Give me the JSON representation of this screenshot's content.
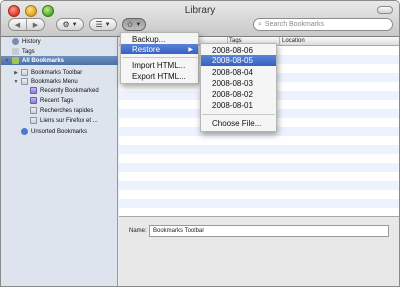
{
  "window": {
    "title": "Library"
  },
  "toolbar": {
    "back_icon": "back-arrow-icon",
    "forward_icon": "forward-arrow-icon",
    "organize_icon": "gear-icon",
    "views_icon": "list-view-icon",
    "import_backup_icon": "star-icon",
    "search": {
      "placeholder": "Search Bookmarks",
      "value": ""
    }
  },
  "sidebar": {
    "items": [
      {
        "label": "History",
        "icon": "history-icon",
        "indent": 0,
        "disclosure": "",
        "selected": false
      },
      {
        "label": "Tags",
        "icon": "tags-icon",
        "indent": 0,
        "disclosure": "",
        "selected": false
      },
      {
        "label": "All Bookmarks",
        "icon": "star-icon",
        "indent": 0,
        "disclosure": "▼",
        "selected": true
      },
      {
        "label": "Bookmarks Toolbar",
        "icon": "folder-icon",
        "indent": 1,
        "disclosure": "▶",
        "selected": false
      },
      {
        "label": "Bookmarks Menu",
        "icon": "folder-icon",
        "indent": 1,
        "disclosure": "▼",
        "selected": false
      },
      {
        "label": "Recently Bookmarked",
        "icon": "smart-folder-icon",
        "indent": 2,
        "disclosure": "",
        "selected": false
      },
      {
        "label": "Recent Tags",
        "icon": "smart-folder-icon",
        "indent": 2,
        "disclosure": "",
        "selected": false
      },
      {
        "label": "Recherches rapides",
        "icon": "folder-icon",
        "indent": 2,
        "disclosure": "",
        "selected": false
      },
      {
        "label": "Liens sur Firefox et ...",
        "icon": "folder-icon",
        "indent": 2,
        "disclosure": "",
        "selected": false
      },
      {
        "label": "Unsorted Bookmarks",
        "icon": "unsorted-icon",
        "indent": 1,
        "disclosure": "",
        "selected": false
      }
    ]
  },
  "main": {
    "columns": [
      "Tags",
      "Location"
    ]
  },
  "details": {
    "name_label": "Name:",
    "name_value": "Bookmarks Toolbar"
  },
  "menu": {
    "items": [
      "Backup...",
      "Restore",
      "Import HTML...",
      "Export HTML..."
    ],
    "active_index": 1
  },
  "submenu": {
    "items": [
      "2008-08-06",
      "2008-08-05",
      "2008-08-04",
      "2008-08-03",
      "2008-08-02",
      "2008-08-01"
    ],
    "active_index": 1,
    "choose_file": "Choose File..."
  },
  "colors": {
    "selection": "#3562c4",
    "sidebar_bg": "#dde4ed",
    "sidebar_selected": "#4c6fa6"
  }
}
